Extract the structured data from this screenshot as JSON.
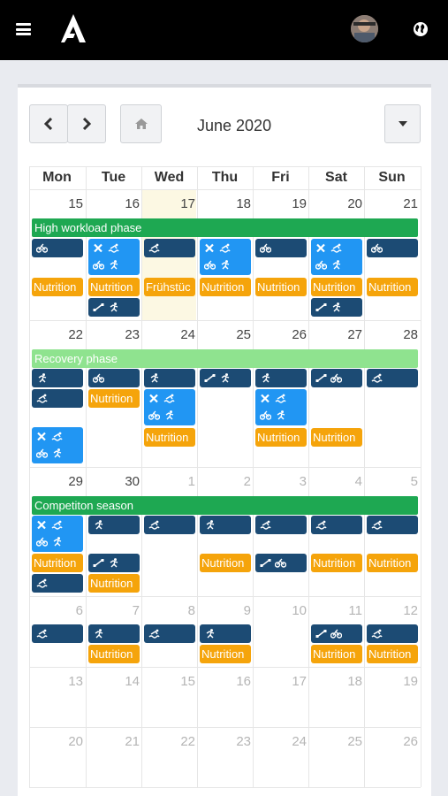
{
  "header": {
    "menu_icon": "hamburger-icon",
    "logo": "A",
    "avatar_icon": "user-avatar",
    "globe_icon": "globe-icon"
  },
  "toolbar": {
    "prev_icon": "chevron-left-icon",
    "next_icon": "chevron-right-icon",
    "home_icon": "home-icon",
    "dropdown_icon": "caret-down-icon",
    "month": "June 2020"
  },
  "weekdays": [
    "Mon",
    "Tue",
    "Wed",
    "Thu",
    "Fri",
    "Sat",
    "Sun"
  ],
  "weeks": [
    {
      "days": [
        "15",
        "16",
        "17",
        "18",
        "19",
        "20",
        "21"
      ],
      "other_month": [
        false,
        false,
        false,
        false,
        false,
        false,
        false
      ],
      "phase": {
        "label": "High workload phase",
        "color": "#1ea852"
      }
    },
    {
      "days": [
        "22",
        "23",
        "24",
        "25",
        "26",
        "27",
        "28"
      ],
      "other_month": [
        false,
        false,
        false,
        false,
        false,
        false,
        false
      ],
      "phase": {
        "label": "Recovery phase",
        "color": "#8fe38f"
      }
    },
    {
      "days": [
        "29",
        "30",
        "1",
        "2",
        "3",
        "4",
        "5"
      ],
      "other_month": [
        false,
        false,
        true,
        true,
        true,
        true,
        true
      ],
      "phase": {
        "label": "Competiton season",
        "color": "#1ea852"
      }
    },
    {
      "days": [
        "6",
        "7",
        "8",
        "9",
        "10",
        "11",
        "12"
      ],
      "other_month": [
        true,
        true,
        true,
        true,
        true,
        true,
        true
      ],
      "phase": null
    },
    {
      "days": [
        "13",
        "14",
        "15",
        "16",
        "17",
        "18",
        "19"
      ],
      "other_month": [
        true,
        true,
        true,
        true,
        true,
        true,
        true
      ],
      "phase": null
    },
    {
      "days": [
        "20",
        "21",
        "22",
        "23",
        "24",
        "25",
        "26"
      ],
      "other_month": [
        true,
        true,
        true,
        true,
        true,
        true,
        true
      ],
      "phase": null
    }
  ],
  "nutrition_label": "Nutrition",
  "breakfast_label": "Frühstüc",
  "colors": {
    "event_dark": "#1c4b74",
    "event_light": "#2196f3",
    "nutrition": "#f5a40b",
    "today": "#fcf8e3"
  }
}
